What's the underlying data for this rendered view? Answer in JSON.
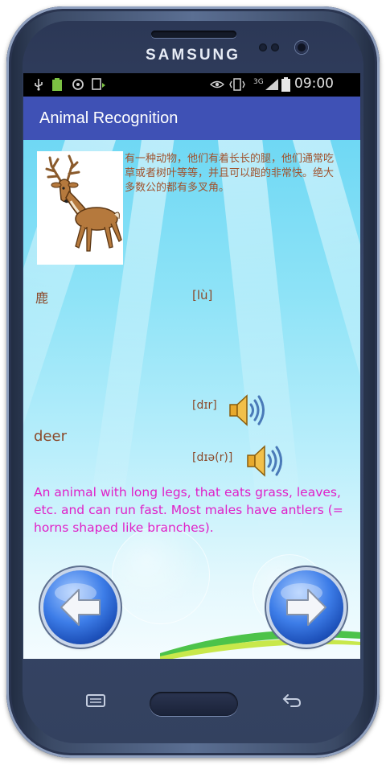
{
  "device": {
    "brand": "SAMSUNG"
  },
  "status_bar": {
    "time": "09:00",
    "network": "3G",
    "icons": [
      "usb-icon",
      "battery-charging-icon",
      "sync-icon",
      "download-icon",
      "eye-icon",
      "vibrate-icon",
      "signal-icon",
      "battery-icon"
    ]
  },
  "app": {
    "title": "Animal Recognition"
  },
  "animal": {
    "chinese_description": "有一种动物，他们有着长长的腿，他们通常吃草或者树叶等等，并且可以跑的非常快。绝大多数公的都有多叉角。",
    "chinese_word": "鹿",
    "pinyin": "[lù]",
    "english_word": "deer",
    "ipa_1": "[dɪr]",
    "ipa_2": "[dɪə(r)]",
    "definition": "An animal with long legs, that eats grass, leaves, etc. and can run fast. Most males have antlers (= horns shaped like branches)."
  },
  "colors": {
    "appbar": "#3f51b5",
    "definition_text": "#e020c8",
    "word_text": "#8b4a2b"
  }
}
